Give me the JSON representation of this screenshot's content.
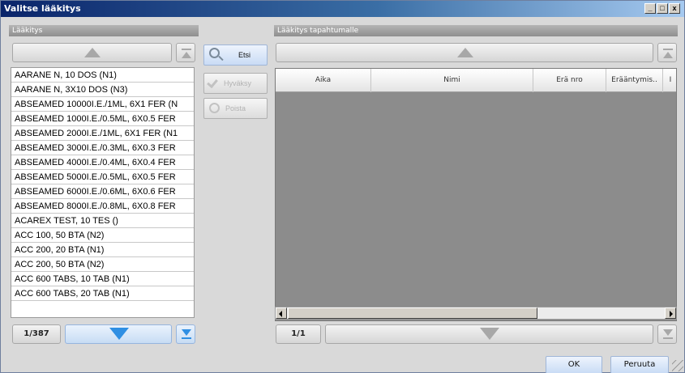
{
  "window": {
    "title": "Valitse lääkitys"
  },
  "title_controls": {
    "minimize": "_",
    "maximize": "□",
    "close": "x"
  },
  "left_panel": {
    "header": "Lääkitys",
    "items": [
      "AARANE N, 10 DOS (N1)",
      "AARANE N, 3X10 DOS (N3)",
      "ABSEAMED 10000I.E./1ML, 6X1 FER (N",
      "ABSEAMED 1000I.E./0.5ML, 6X0.5 FER",
      "ABSEAMED 2000I.E./1ML, 6X1 FER (N1",
      "ABSEAMED 3000I.E./0.3ML, 6X0.3 FER",
      "ABSEAMED 4000I.E./0.4ML, 6X0.4 FER",
      "ABSEAMED 5000I.E./0.5ML, 6X0.5 FER",
      "ABSEAMED 6000I.E./0.6ML, 6X0.6 FER",
      "ABSEAMED 8000I.E./0.8ML, 6X0.8 FER",
      "ACAREX TEST, 10 TES ()",
      "ACC 100, 50 BTA (N2)",
      "ACC 200, 20 BTA (N1)",
      "ACC 200, 50 BTA (N2)",
      "ACC 600 TABS, 10 TAB (N1)",
      "ACC 600 TABS, 20 TAB (N1)"
    ],
    "page": "1/387"
  },
  "actions": {
    "search": "Etsi",
    "accept": "Hyväksy",
    "remove": "Poista"
  },
  "right_panel": {
    "header": "Lääkitys tapahtumalle",
    "columns": [
      "Aika",
      "Nimi",
      "Erä nro",
      "Erääntymis..",
      "I"
    ],
    "page": "1/1"
  },
  "footer": {
    "ok": "OK",
    "cancel": "Peruuta"
  }
}
